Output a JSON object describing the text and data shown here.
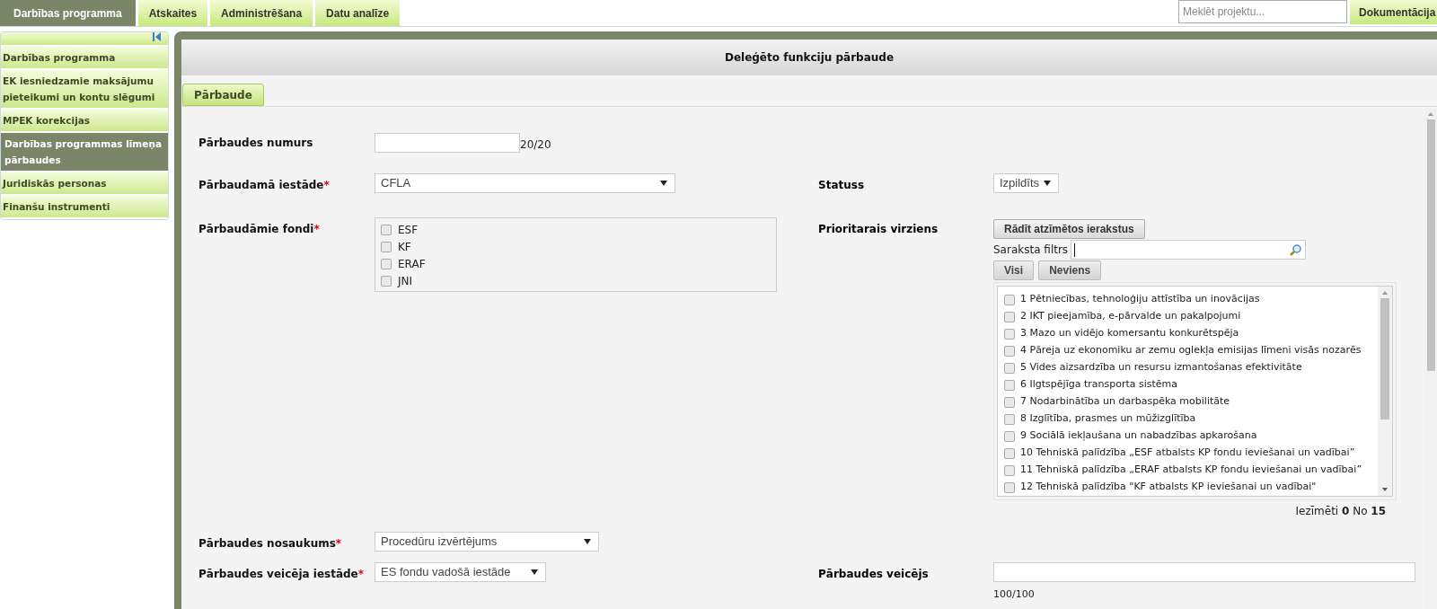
{
  "top_nav": {
    "tabs": [
      {
        "label": "Darbības programma",
        "selected": true
      },
      {
        "label": "Atskaites",
        "selected": false
      },
      {
        "label": "Administrēšana",
        "selected": false
      },
      {
        "label": "Datu analīze",
        "selected": false
      }
    ],
    "search": {
      "placeholder": "Meklēt projektu..."
    },
    "docs_button": "Dokumentācija"
  },
  "sidebar": {
    "items": [
      {
        "label": "Darbības programma",
        "selected": false
      },
      {
        "label": "EK iesniedzamie maksājumu pieteikumi un kontu slēgumi",
        "selected": false
      },
      {
        "label": "MPEK korekcijas",
        "selected": false
      },
      {
        "label": "Darbības programmas līmeņa pārbaudes",
        "selected": true
      },
      {
        "label": "Juridiskās personas",
        "selected": false
      },
      {
        "label": "Finanšu instrumenti",
        "selected": false
      }
    ]
  },
  "panel": {
    "title": "Deleģēto funkciju pārbaude",
    "tabs": [
      {
        "label": "Pārbaude",
        "selected": true
      }
    ],
    "form": {
      "check_number": {
        "label": "Pārbaudes numurs",
        "counter": "20/20"
      },
      "institution": {
        "label": "Pārbaudamā iestāde",
        "required_mark": "*",
        "value": "CFLA"
      },
      "status": {
        "label": "Statuss",
        "value": "Izpildīts"
      },
      "funds": {
        "label": "Pārbaudāmie fondi",
        "required_mark": "*",
        "options": [
          {
            "label": "ESF",
            "checked": false
          },
          {
            "label": "KF",
            "checked": false
          },
          {
            "label": "ERAF",
            "checked": false
          },
          {
            "label": "JNI",
            "checked": false
          }
        ]
      },
      "priority": {
        "label": "Prioritarais virziens",
        "show_marked_button": "Rādīt atzīmētos ierakstus",
        "filter_label": "Saraksta filtrs",
        "all_button": "Visi",
        "none_button": "Neviens",
        "options": [
          {
            "label": "1 Pētniecības, tehnoloģiju attīstība un inovācijas",
            "checked": false
          },
          {
            "label": "2 IKT pieejamība, e-pārvalde un pakalpojumi",
            "checked": false
          },
          {
            "label": "3 Mazo un vidējo komersantu konkurētspēja",
            "checked": false
          },
          {
            "label": "4 Pāreja uz ekonomiku ar zemu oglekļa emisijas līmeni visās nozarēs",
            "checked": false
          },
          {
            "label": "5 Vides aizsardzība un resursu izmantošanas efektivitāte",
            "checked": false
          },
          {
            "label": "6 Ilgtspējīga transporta sistēma",
            "checked": false
          },
          {
            "label": "7 Nodarbinātība un darbaspēka mobilitāte",
            "checked": false
          },
          {
            "label": "8 Izglītība, prasmes un mūžizglītība",
            "checked": false
          },
          {
            "label": "9 Sociālā iekļaušana un nabadzības apkarošana",
            "checked": false
          },
          {
            "label": "10 Tehniskā palīdzība „ESF atbalsts KP fondu ieviešanai un vadībai”",
            "checked": false
          },
          {
            "label": "11 Tehniskā palīdzība „ERAF atbalsts KP fondu ieviešanai un vadībai”",
            "checked": false
          },
          {
            "label": "12 Tehniskā palīdzība \"KF atbalsts KP ieviešanai un vadībai\"",
            "checked": false
          }
        ],
        "summary": "Iezīmēti **0** No **15**"
      },
      "check_name": {
        "label": "Pārbaudes nosaukums",
        "required_mark": "*",
        "value": "Procedūru izvērtējums"
      },
      "performer_institution": {
        "label": "Pārbaudes veicēja iestāde",
        "required_mark": "*",
        "value": "ES fondu vadošā iestāde"
      },
      "performer": {
        "label": "Pārbaudes veicējs",
        "counter": "100/100"
      }
    }
  }
}
